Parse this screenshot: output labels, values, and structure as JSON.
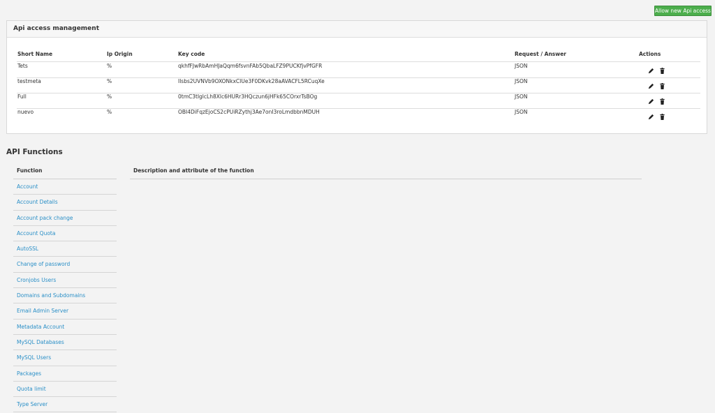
{
  "header": {
    "allow_button": "Allow new Api access"
  },
  "panel": {
    "title": "Api access management",
    "columns": {
      "short_name": "Short Name",
      "ip_origin": "Ip Origin",
      "key_code": "Key code",
      "request_answer": "Request / Answer",
      "actions": "Actions"
    },
    "rows": [
      {
        "short_name": "Tets",
        "ip_origin": "%",
        "key_code": "qkhfFJwRbAmHJaQqm6fsvnFAb5QbaLFZ9PUCKfjvPfGFR",
        "request_answer": "JSON"
      },
      {
        "short_name": "testmeta",
        "ip_origin": "%",
        "key_code": "Ilsbs2UVNVb9OXONkxCIUe3F0DKvk28aAVACFL5RCuqXe",
        "request_answer": "JSON"
      },
      {
        "short_name": "Full",
        "ip_origin": "%",
        "key_code": "0tmC3tlglcLh8Xlc6HURr3HQczun6jHFk65COrxrTsBOg",
        "request_answer": "JSON"
      },
      {
        "short_name": "nuevo",
        "ip_origin": "%",
        "key_code": "OBI4DiFqzEjoCS2cPUiRZythj3Ae7onI3roLmdbbnMDUH",
        "request_answer": "JSON"
      }
    ],
    "icons": {
      "edit": "pencil-icon",
      "delete": "trash-icon"
    }
  },
  "api_functions": {
    "title": "API Functions",
    "function_header": "Function",
    "description_header": "Description and attribute of the function",
    "items": [
      "Account",
      "Account Details",
      "Account pack change",
      "Account Quota",
      "AutoSSL",
      "Change of password",
      "Cronjobs Users",
      "Domains and Subdomains",
      "Email Admin Server",
      "Metadata Account",
      "MySQL Databases",
      "MySQL Users",
      "Packages",
      "Quota limit",
      "Type Server"
    ]
  },
  "colors": {
    "accent_green": "#4cae4c",
    "link_blue": "#2a8fc7"
  }
}
